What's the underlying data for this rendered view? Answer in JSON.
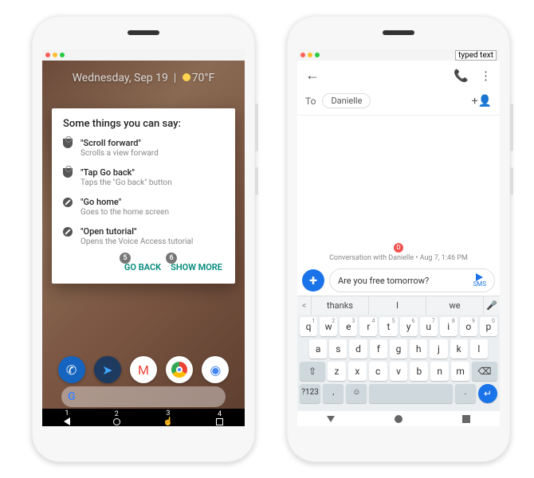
{
  "left": {
    "date": "Wednesday, Sep 19",
    "weather": "70°F",
    "card": {
      "title": "Some things you can say:",
      "hints": [
        {
          "icon": "tap",
          "cmd": "\"Scroll forward\"",
          "desc": "Scrolls a view forward"
        },
        {
          "icon": "tap",
          "cmd": "\"Tap Go back\"",
          "desc": "Taps the \"Go back\" button"
        },
        {
          "icon": "compass",
          "cmd": "\"Go home\"",
          "desc": "Goes to the home screen"
        },
        {
          "icon": "compass",
          "cmd": "\"Open tutorial\"",
          "desc": "Opens the Voice Access tutorial"
        }
      ],
      "actions": {
        "back": "GO BACK",
        "more": "SHOW MORE",
        "back_num": "5",
        "more_num": "6"
      }
    },
    "search": "G",
    "nav_nums": [
      "1",
      "2",
      "3",
      "4"
    ]
  },
  "right": {
    "window_label": "typed text",
    "to_label": "To",
    "recipient": "Danielle",
    "conv_badge": "D",
    "conv_meta": "Conversation with Danielle • Aug 7, 1:46 PM",
    "compose_text": "Are you free tomorrow?",
    "send_label": "SMS",
    "suggestions": [
      "thanks",
      "I",
      "we"
    ],
    "keyboard": {
      "row1": [
        {
          "k": "q",
          "s": "1"
        },
        {
          "k": "w",
          "s": "2"
        },
        {
          "k": "e",
          "s": "3"
        },
        {
          "k": "r",
          "s": "4"
        },
        {
          "k": "t",
          "s": "5"
        },
        {
          "k": "y",
          "s": "6"
        },
        {
          "k": "u",
          "s": "7"
        },
        {
          "k": "i",
          "s": "8"
        },
        {
          "k": "o",
          "s": "9"
        },
        {
          "k": "p",
          "s": "0"
        }
      ],
      "row2": [
        "a",
        "s",
        "d",
        "f",
        "g",
        "h",
        "j",
        "k",
        "l"
      ],
      "row3": [
        "z",
        "x",
        "c",
        "v",
        "b",
        "n",
        "m"
      ],
      "sym": "?123",
      "comma": ",",
      "period": "."
    }
  }
}
